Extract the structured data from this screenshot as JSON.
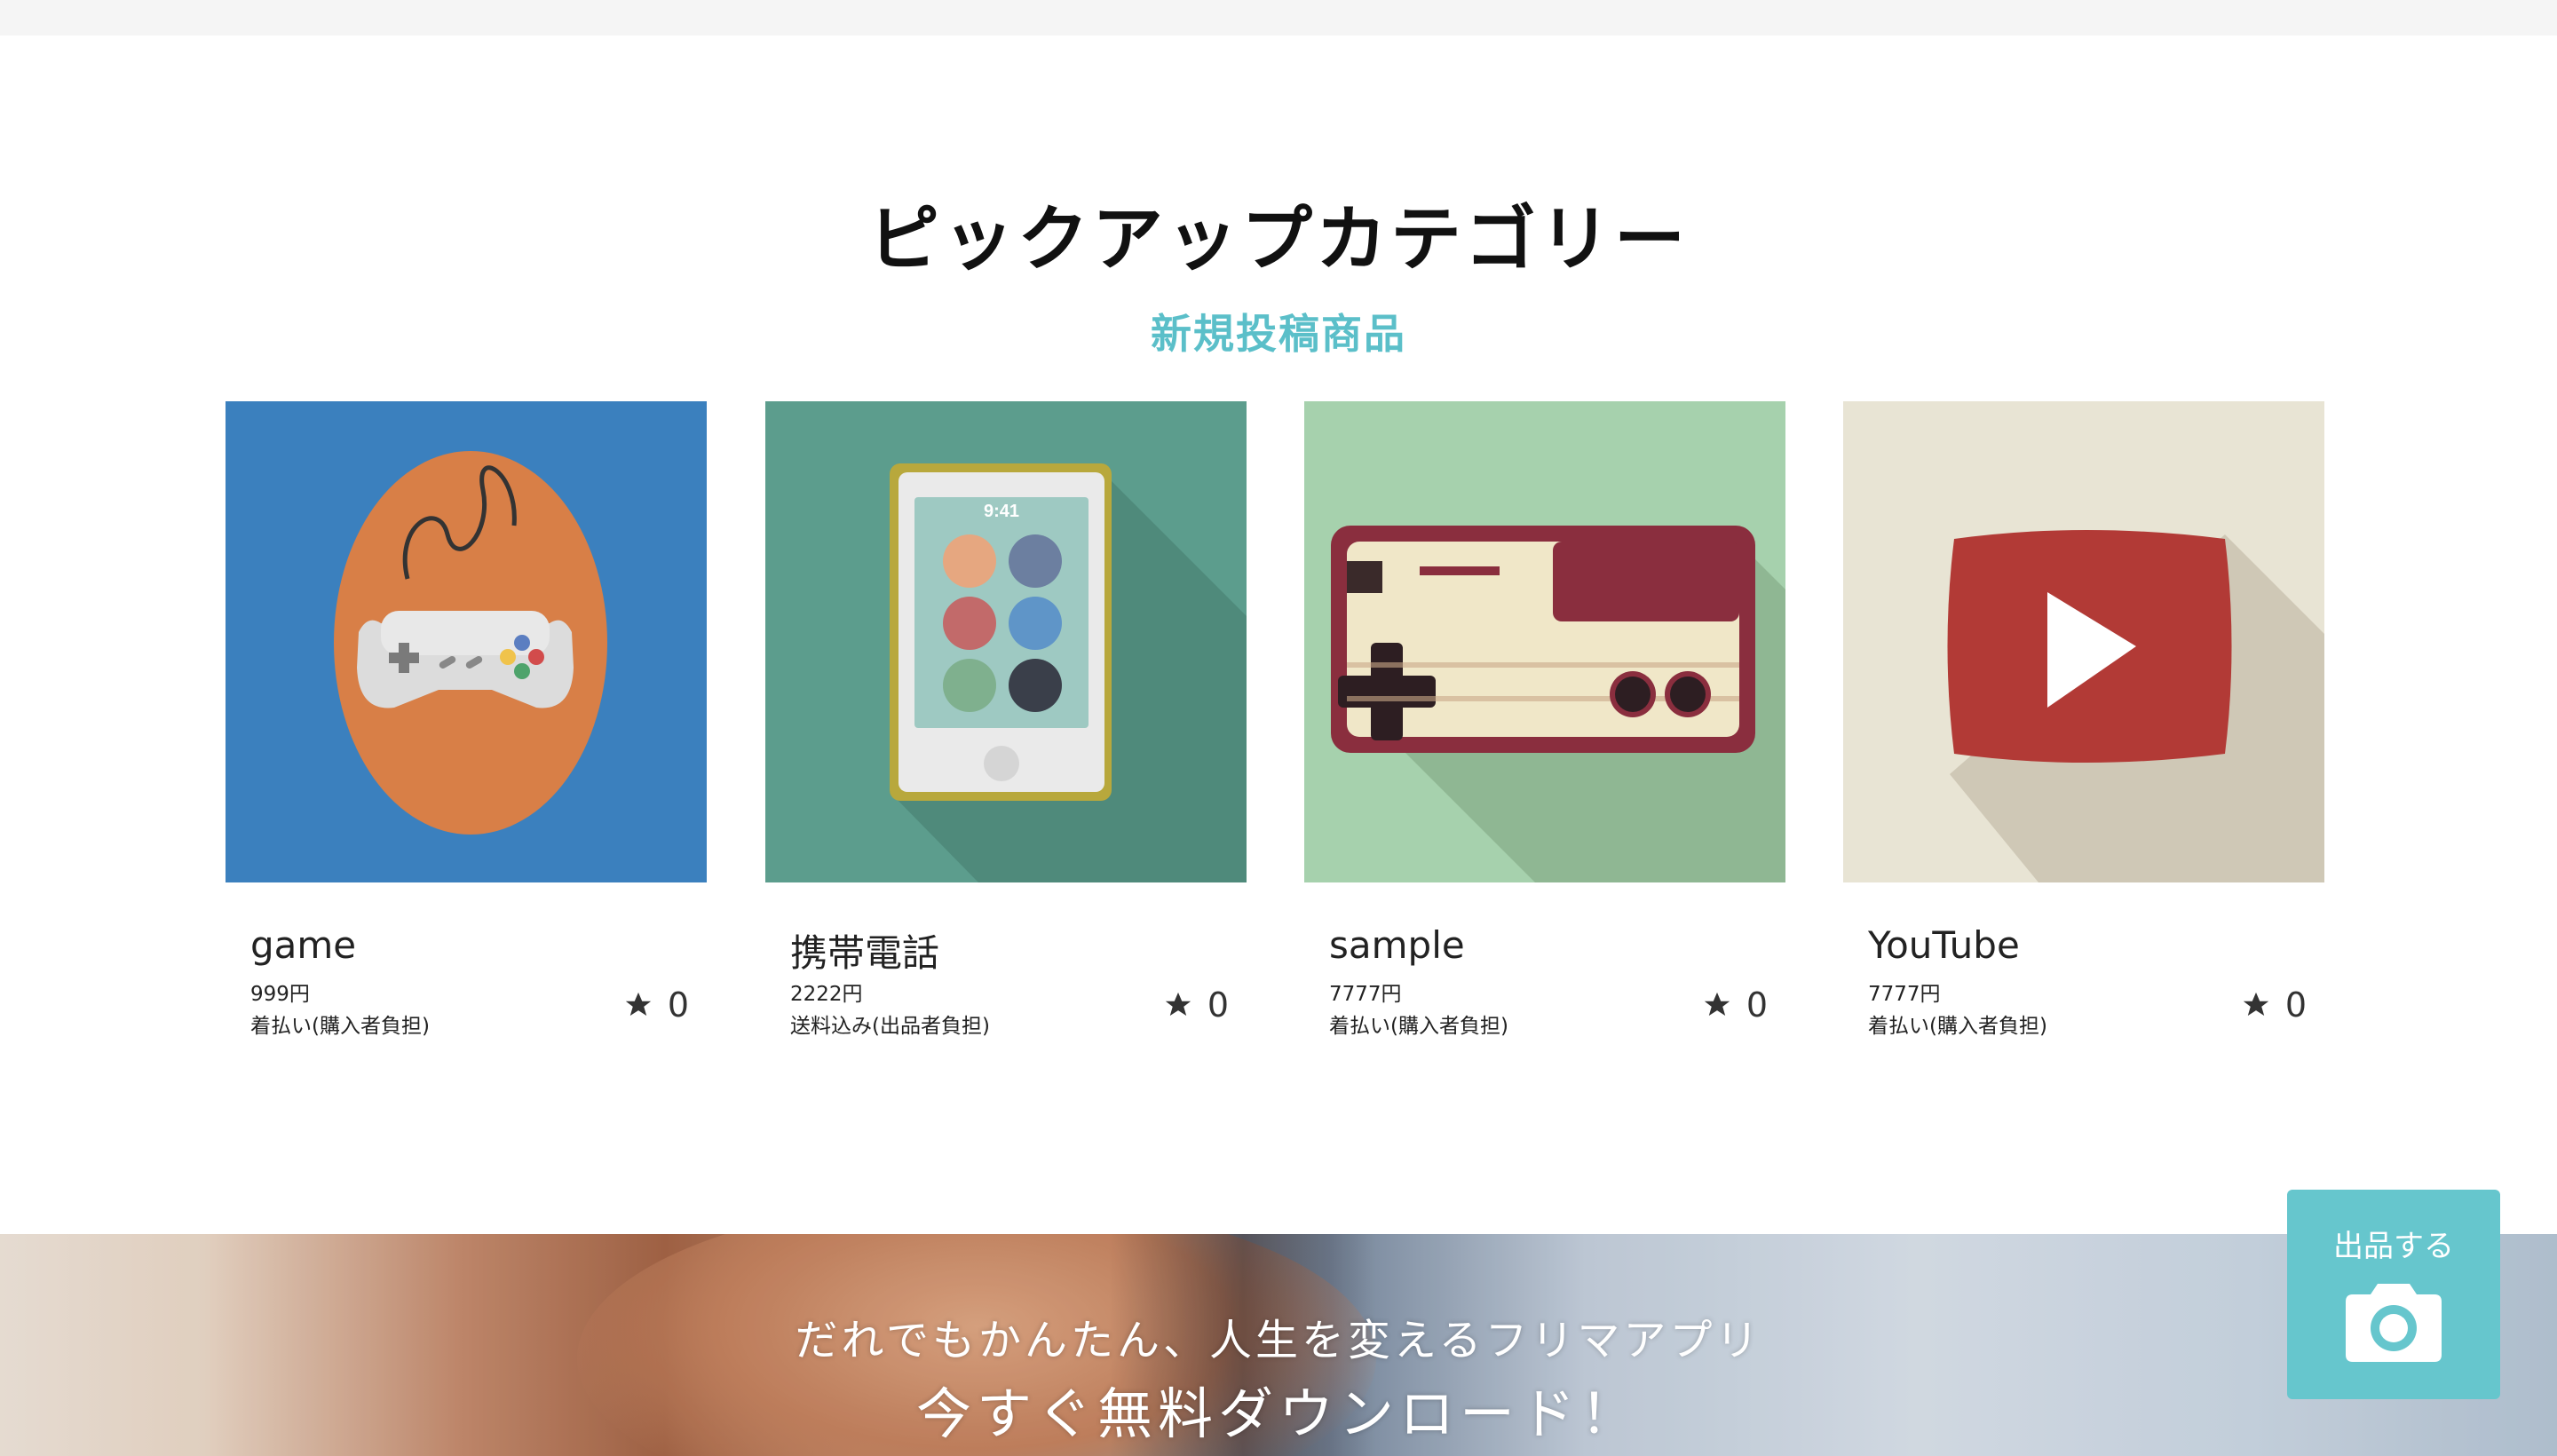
{
  "section": {
    "title": "ピックアップカテゴリー",
    "subtitle": "新規投稿商品"
  },
  "products": [
    {
      "name": "game",
      "price": "999円",
      "shipping": "着払い(購入者負担)",
      "likes": "0",
      "image_icon": "game-controller-icon",
      "bg": "#3b80be"
    },
    {
      "name": "携帯電話",
      "price": "2222円",
      "shipping": "送料込み(出品者負担)",
      "likes": "0",
      "image_icon": "music-player-icon",
      "bg": "#5c9d8d"
    },
    {
      "name": "sample",
      "price": "7777円",
      "shipping": "着払い(購入者負担)",
      "likes": "0",
      "image_icon": "famicom-controller-icon",
      "bg": "#a6d1ad"
    },
    {
      "name": "YouTube",
      "price": "7777円",
      "shipping": "着払い(購入者負担)",
      "likes": "0",
      "image_icon": "video-play-icon",
      "bg": "#e8e4d4"
    }
  ],
  "banner": {
    "line1": "だれでもかんたん、人生を変えるフリマアプリ",
    "line2": "今すぐ無料ダウンロード！"
  },
  "sell_button": {
    "label": "出品する",
    "icon": "camera-icon",
    "color": "#66c6cd"
  },
  "player_screen": {
    "time": "9:41"
  },
  "colors": {
    "accent": "#5bbfc9"
  }
}
